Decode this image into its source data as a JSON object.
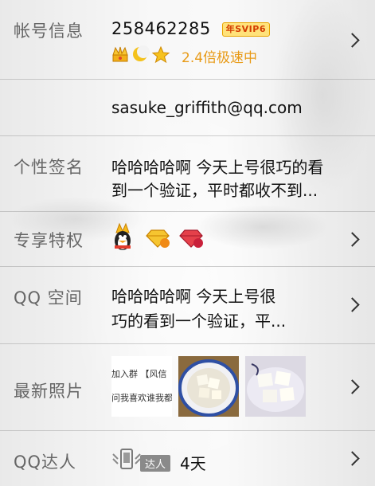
{
  "account": {
    "label": "帐号信息",
    "qq_number": "258462285",
    "vip_badge": "年SVIP6",
    "speed_text": "2.4倍极速中",
    "level_icons": [
      "crown-icon",
      "moon-icon",
      "star-icon"
    ]
  },
  "email": {
    "value": "sasuke_griffith@qq.com"
  },
  "signature": {
    "label": "个性签名",
    "line1": "哈哈哈哈啊  今天上号很巧的看",
    "line2": "到一个验证，平时都收不到..."
  },
  "privileges": {
    "label": "专享特权",
    "badges": [
      "qq-penguin-icon",
      "yellow-diamond-badge",
      "red-diamond-badge"
    ]
  },
  "qzone": {
    "label": "QQ 空间",
    "line1": "哈哈哈哈啊  今天上号很",
    "line2": "巧的看到一个验证，平..."
  },
  "photos": {
    "label": "最新照片",
    "photo1_text": [
      "加入群 【风信",
      "问我喜欢谁我都"
    ]
  },
  "daren": {
    "label": "QQ达人",
    "badge_text": "达人",
    "days": "4天"
  }
}
